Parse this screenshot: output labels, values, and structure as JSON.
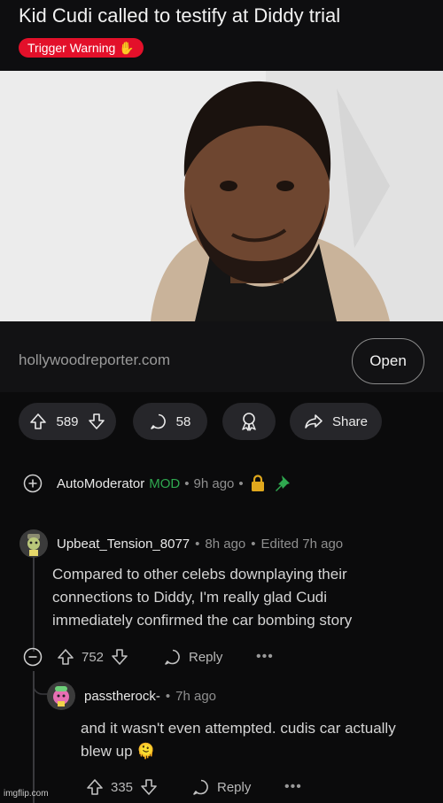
{
  "post": {
    "title": "Kid Cudi called to testify at Diddy trial",
    "flair": "Trigger Warning ✋",
    "domain": "hollywoodreporter.com",
    "open_label": "Open",
    "upvotes": "589",
    "comments": "58",
    "share_label": "Share"
  },
  "automod": {
    "username": "AutoModerator",
    "badge": "MOD",
    "separator": "•",
    "time": "9h ago"
  },
  "comment1": {
    "username": "Upbeat_Tension_8077",
    "time": "8h ago",
    "edited": "Edited 7h ago",
    "separator": "•",
    "body": "Compared to other celebs downplaying their connections to Diddy, I'm really glad Cudi immediately confirmed the car bombing story",
    "votes": "752",
    "reply_label": "Reply",
    "more": "•••"
  },
  "comment2": {
    "username": "passtherock-",
    "time": "7h ago",
    "separator": "•",
    "body": "and it wasn't even attempted. cudis car actually blew up 🫠",
    "votes": "335",
    "reply_label": "Reply",
    "more": "•••"
  },
  "watermark": "imgflip.com",
  "colors": {
    "flair_bg": "#e3102a",
    "mod_green": "#2fa84f",
    "pill_bg": "#26262a"
  }
}
